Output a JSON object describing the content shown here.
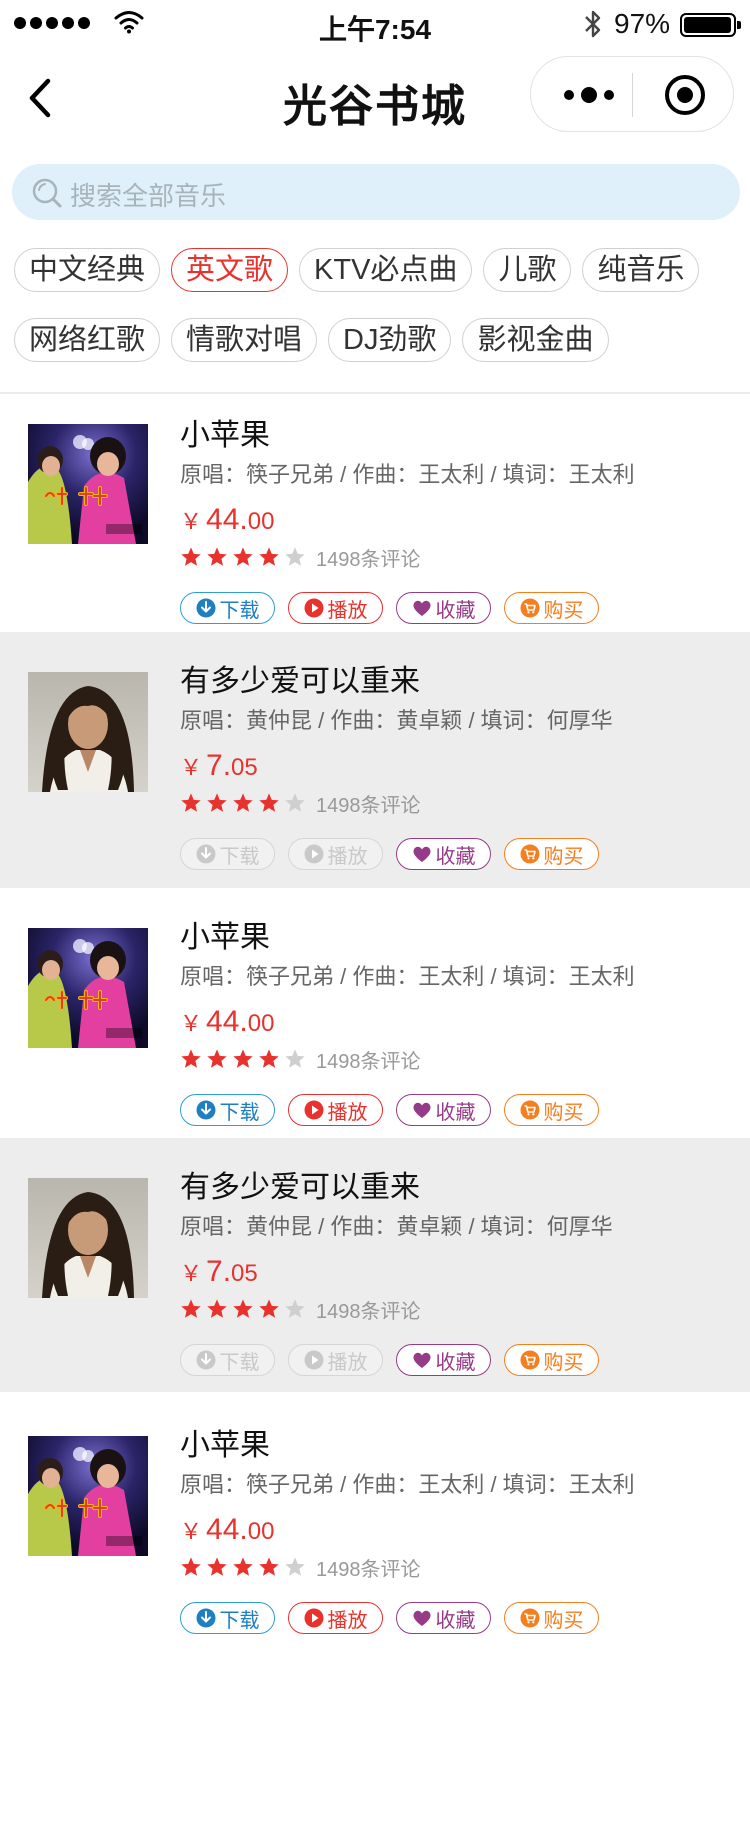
{
  "status_bar": {
    "time": "上午7:54",
    "battery_percent": "97%",
    "battery_level": 0.97
  },
  "nav": {
    "title": "光谷书城",
    "back_icon": "chevron-left-icon",
    "more_icon": "more-dots-icon",
    "close_icon": "target-circle-icon"
  },
  "search": {
    "placeholder": "搜索全部音乐",
    "icon": "search-icon"
  },
  "tags": [
    {
      "label": "中文经典",
      "active": false
    },
    {
      "label": "英文歌",
      "active": true
    },
    {
      "label": "KTV必点曲",
      "active": false
    },
    {
      "label": "儿歌",
      "active": false
    },
    {
      "label": "纯音乐",
      "active": false
    },
    {
      "label": "网络红歌",
      "active": false
    },
    {
      "label": "情歌对唱",
      "active": false
    },
    {
      "label": "DJ劲歌",
      "active": false
    },
    {
      "label": "影视金曲",
      "active": false
    }
  ],
  "actions": {
    "download": "下载",
    "play": "播放",
    "favorite": "收藏",
    "buy": "购买"
  },
  "colors": {
    "accent_red": "#e8322d",
    "download_blue": "#1f7fc1",
    "favorite_purple": "#963b88",
    "buy_orange": "#f57e1f",
    "search_bg": "#dff0fb"
  },
  "songs": [
    {
      "title": "小苹果",
      "meta": "原唱：筷子兄弟 / 作曲：王太利 / 填词：王太利",
      "price_symbol": "￥",
      "price_int": "44.",
      "price_dec": "00",
      "rating": 4,
      "reviews": "1498条评论",
      "cover": "album-cover-xiaopingguo",
      "background": "white",
      "download_enabled": true,
      "play_enabled": true
    },
    {
      "title": "有多少爱可以重来",
      "meta": "原唱：黄仲昆 / 作曲：黄卓颖 / 填词：何厚华",
      "price_symbol": "￥",
      "price_int": "7.",
      "price_dec": "05",
      "rating": 4,
      "reviews": "1498条评论",
      "cover": "artist-portrait-long-hair",
      "background": "gray",
      "download_enabled": false,
      "play_enabled": false
    },
    {
      "title": "小苹果",
      "meta": "原唱：筷子兄弟 / 作曲：王太利 / 填词：王太利",
      "price_symbol": "￥",
      "price_int": "44.",
      "price_dec": "00",
      "rating": 4,
      "reviews": "1498条评论",
      "cover": "album-cover-xiaopingguo",
      "background": "white",
      "download_enabled": true,
      "play_enabled": true
    },
    {
      "title": "有多少爱可以重来",
      "meta": "原唱：黄仲昆 / 作曲：黄卓颖 / 填词：何厚华",
      "price_symbol": "￥",
      "price_int": "7.",
      "price_dec": "05",
      "rating": 4,
      "reviews": "1498条评论",
      "cover": "artist-portrait-long-hair",
      "background": "gray",
      "download_enabled": false,
      "play_enabled": false
    },
    {
      "title": "小苹果",
      "meta": "原唱：筷子兄弟 / 作曲：王太利 / 填词：王太利",
      "price_symbol": "￥",
      "price_int": "44.",
      "price_dec": "00",
      "rating": 4,
      "reviews": "1498条评论",
      "cover": "album-cover-xiaopingguo",
      "background": "white",
      "download_enabled": true,
      "play_enabled": true
    }
  ]
}
